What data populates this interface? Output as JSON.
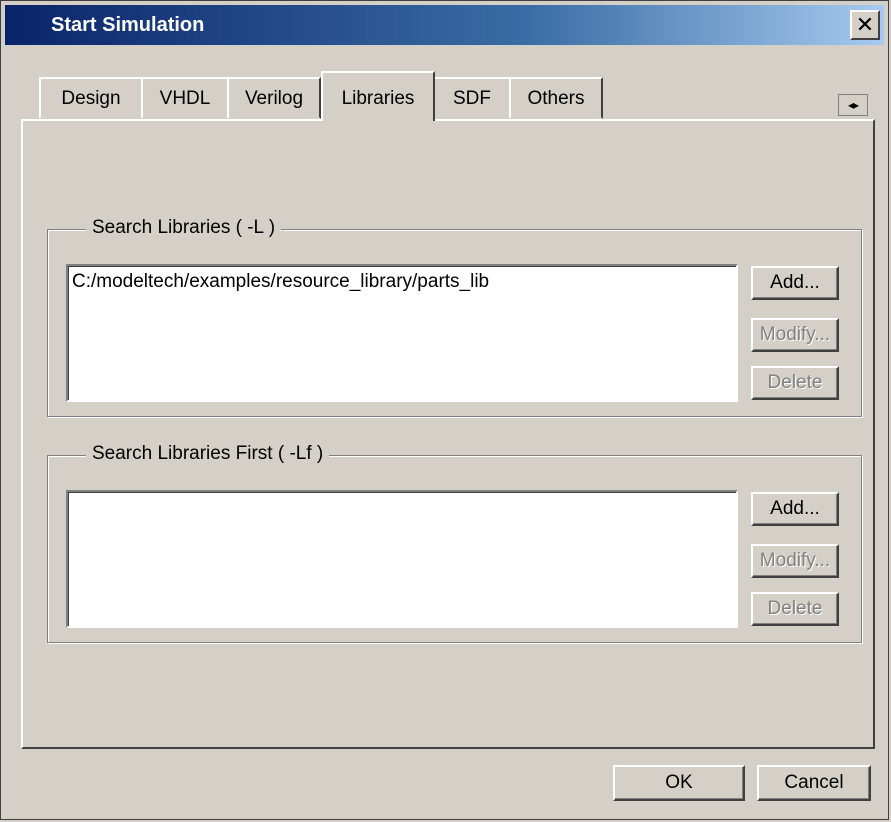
{
  "window": {
    "title": "Start Simulation",
    "close_glyph": "✕"
  },
  "tabs": [
    {
      "label": "Design",
      "active": false
    },
    {
      "label": "VHDL",
      "active": false
    },
    {
      "label": "Verilog",
      "active": false
    },
    {
      "label": "Libraries",
      "active": true
    },
    {
      "label": "SDF",
      "active": false
    },
    {
      "label": "Others",
      "active": false
    }
  ],
  "tab_scroll": {
    "left_glyph": "◂",
    "right_glyph": "▸"
  },
  "search_libraries": {
    "label": "Search Libraries ( -L )",
    "items": [
      "C:/modeltech/examples/resource_library/parts_lib"
    ],
    "add_label": "Add...",
    "modify_label": "Modify...",
    "delete_label": "Delete"
  },
  "search_libraries_first": {
    "label": "Search Libraries First ( -Lf )",
    "items": [],
    "add_label": "Add...",
    "modify_label": "Modify...",
    "delete_label": "Delete"
  },
  "footer": {
    "ok_label": "OK",
    "cancel_label": "Cancel"
  },
  "colors": {
    "face": "#d4d0c8",
    "title_start": "#0a246a",
    "title_end": "#a6caf0",
    "disabled_text": "#808080"
  },
  "icons": {
    "close": "close-icon",
    "tab_scroll_left": "chevron-left-icon",
    "tab_scroll_right": "chevron-right-icon"
  }
}
